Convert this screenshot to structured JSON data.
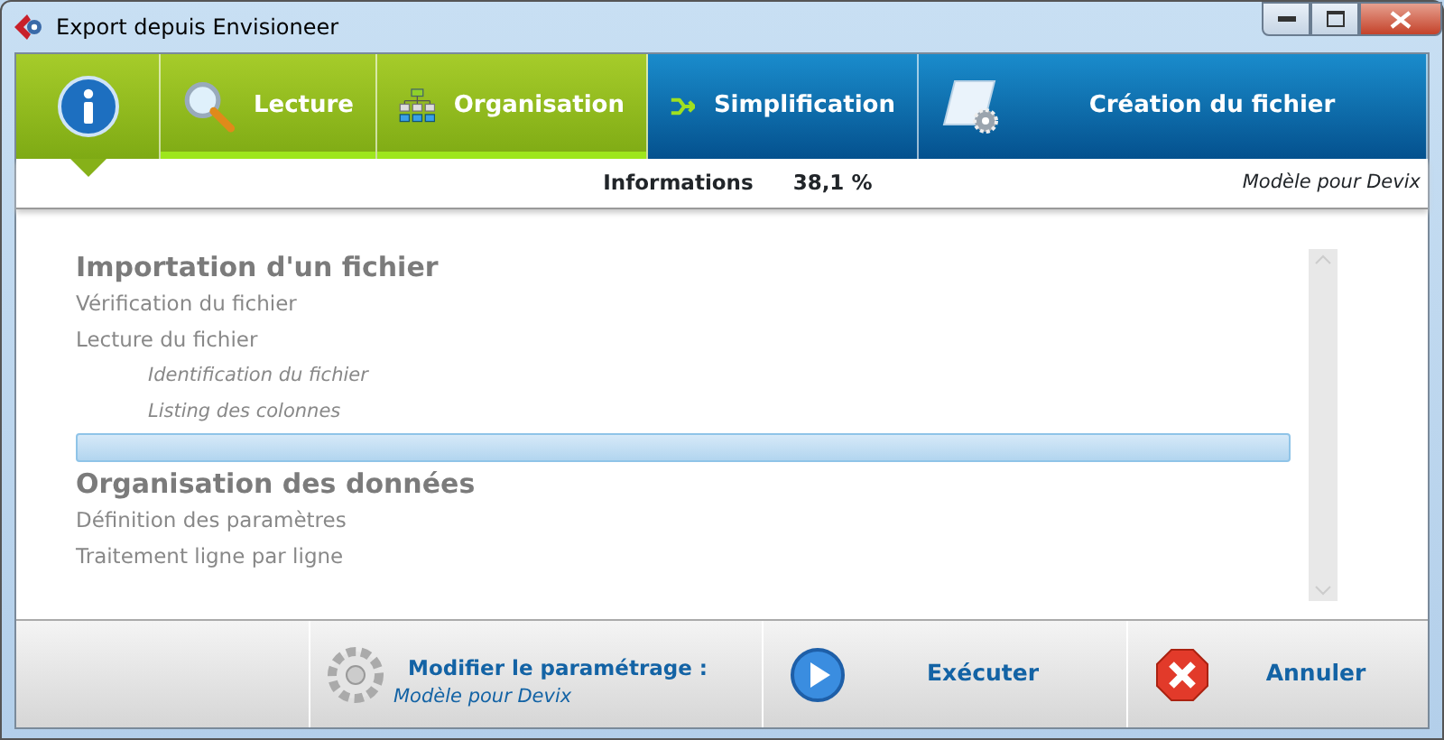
{
  "window": {
    "title": "Export depuis Envisioneer"
  },
  "tabs": [
    {
      "kind": "info",
      "selected": true,
      "done": true
    },
    {
      "label": "Lecture",
      "kind": "search",
      "selected": false,
      "done": true
    },
    {
      "label": "Organisation",
      "kind": "hierarchy",
      "selected": false,
      "done": true
    },
    {
      "label": "Simplification",
      "kind": "merge",
      "selected": false,
      "done": false
    },
    {
      "label": "Création du fichier",
      "kind": "scroll",
      "selected": false,
      "done": false
    }
  ],
  "info_bar": {
    "label": "Informations",
    "progress": "38,1 %",
    "model": "Modèle pour Devix"
  },
  "steps": [
    {
      "text": "Importation d'un fichier",
      "kind": "heading",
      "selected": false
    },
    {
      "text": "Vérification du fichier",
      "kind": "step",
      "selected": false
    },
    {
      "text": "Lecture du fichier",
      "kind": "step",
      "selected": false
    },
    {
      "text": "Identification du fichier",
      "kind": "substep",
      "selected": false
    },
    {
      "text": "Listing des colonnes",
      "kind": "substep",
      "selected": false
    },
    {
      "kind": "blank",
      "selected": true
    },
    {
      "text": "Organisation des données",
      "kind": "heading",
      "selected": false
    },
    {
      "text": "Définition des paramètres",
      "kind": "step",
      "selected": false
    },
    {
      "text": "Traitement ligne par ligne",
      "kind": "step",
      "selected": false
    }
  ],
  "footer": {
    "settings_label": "Modifier le paramétrage :",
    "settings_model": "Modèle pour Devix",
    "run": "Exécuter",
    "cancel": "Annuler"
  }
}
